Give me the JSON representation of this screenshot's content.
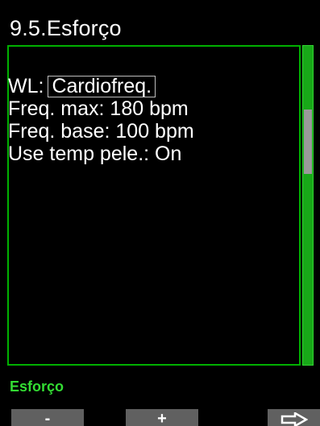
{
  "screen": {
    "title": "9.5.Esforço",
    "status_label": "Esforço"
  },
  "settings": {
    "wl": {
      "label": "WL:",
      "value": "Cardiofreq."
    },
    "rows": [
      "Freq. max: 180 bpm",
      "Freq. base: 100 bpm",
      "Use temp pele.: On"
    ]
  },
  "softkeys": {
    "left": "-",
    "middle": "+",
    "right_icon": "right-arrow-icon"
  },
  "scroll": {
    "position_fraction": 0.2
  },
  "colors": {
    "background": "#000000",
    "text": "#ffffff",
    "accent_green": "#00b000",
    "status_green": "#33dd33",
    "softkey_gray": "#606060",
    "scroll_thumb": "#9a9a9a"
  }
}
